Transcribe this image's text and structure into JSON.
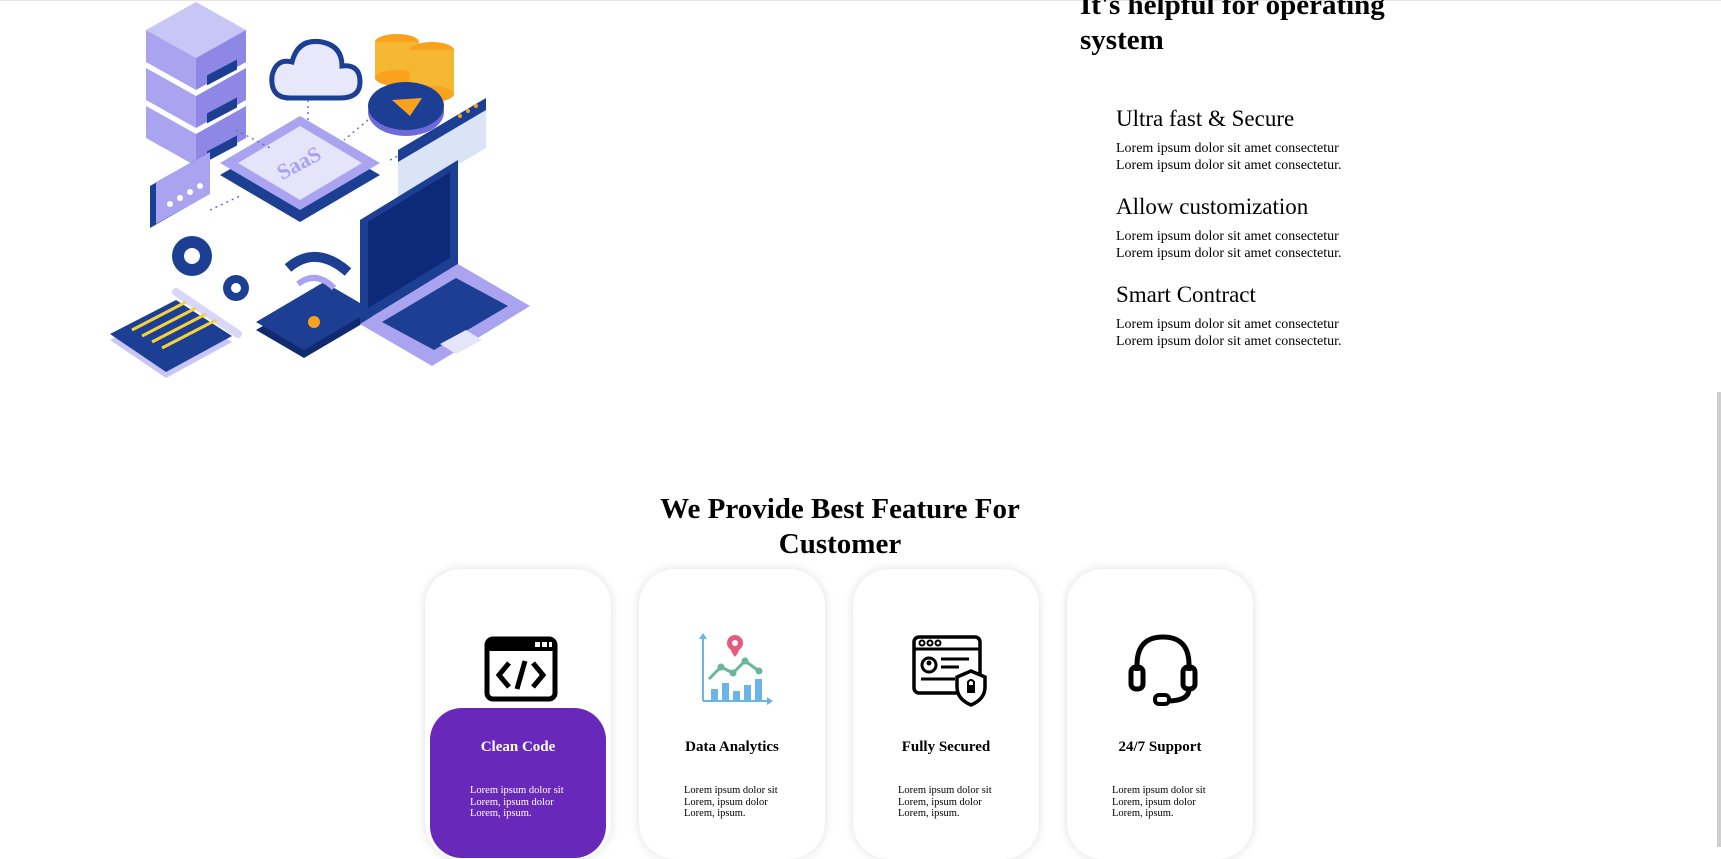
{
  "hero": {
    "title": "It's helpful for operating system",
    "illustration_label": "SaaS",
    "features": [
      {
        "title": "Ultra fast & Secure",
        "text": "Lorem ipsum dolor sit amet consectetur Lorem ipsum dolor sit amet consectetur."
      },
      {
        "title": "Allow customization",
        "text": "Lorem ipsum dolor sit amet consectetur Lorem ipsum dolor sit amet consectetur."
      },
      {
        "title": "Smart Contract",
        "text": "Lorem ipsum dolor sit amet consectetur Lorem ipsum dolor sit amet consectetur."
      }
    ]
  },
  "services": {
    "title": "We Provide Best Feature For Customer",
    "cards": [
      {
        "title": "Clean Code",
        "desc": "Lorem ipsum dolor sit Lorem, ipsum dolor Lorem, ipsum.",
        "icon": "code-window-icon"
      },
      {
        "title": "Data Analytics",
        "desc": "Lorem ipsum dolor sit Lorem, ipsum dolor Lorem, ipsum.",
        "icon": "analytics-chart-icon"
      },
      {
        "title": "Fully Secured",
        "desc": "Lorem ipsum dolor sit Lorem, ipsum dolor Lorem, ipsum.",
        "icon": "secure-profile-icon"
      },
      {
        "title": "24/7 Support",
        "desc": "Lorem ipsum dolor sit Lorem, ipsum dolor Lorem, ipsum.",
        "icon": "headset-icon"
      }
    ]
  },
  "colors": {
    "accent": "#6829bb",
    "illustration_navy": "#1c3f94",
    "illustration_lavender": "#a9a3f0",
    "coin": "#f9a21b"
  }
}
